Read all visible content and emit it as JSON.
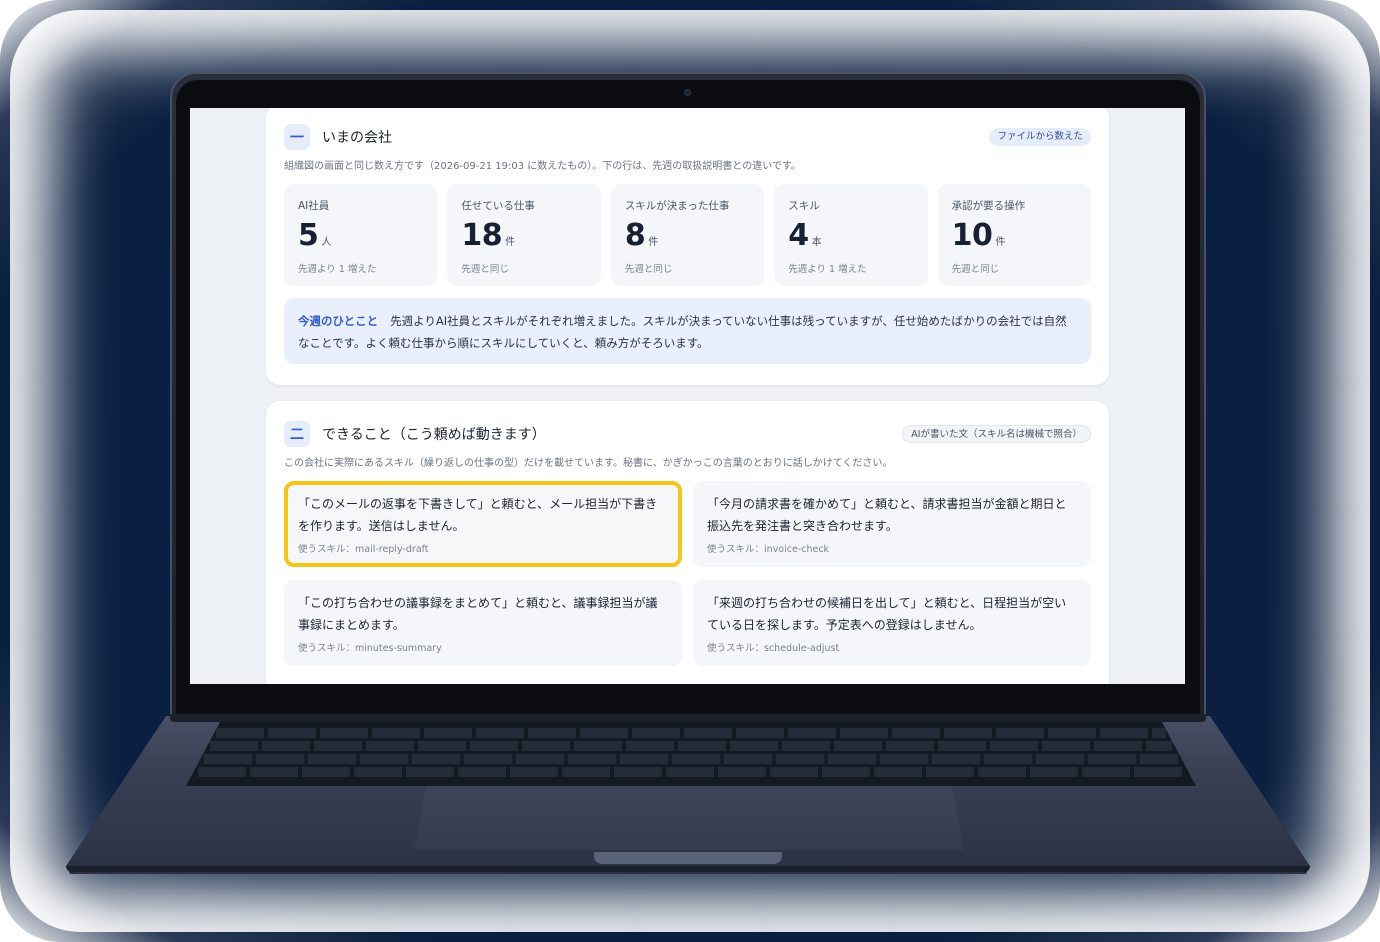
{
  "section1": {
    "number": "一",
    "title": "いまの会社",
    "badge": "ファイルから数えた",
    "description": "組織図の画面と同じ数え方です（2026-09-21 19:03 に数えたもの）。下の行は、先週の取扱説明書との違いです。",
    "stats": [
      {
        "label": "AI社員",
        "value": "5",
        "unit": "人",
        "sub": "先週より 1 増えた"
      },
      {
        "label": "任せている仕事",
        "value": "18",
        "unit": "件",
        "sub": "先週と同じ"
      },
      {
        "label": "スキルが決まった仕事",
        "value": "8",
        "unit": "件",
        "sub": "先週と同じ"
      },
      {
        "label": "スキル",
        "value": "4",
        "unit": "本",
        "sub": "先週より 1 増えた"
      },
      {
        "label": "承認が要る操作",
        "value": "10",
        "unit": "件",
        "sub": "先週と同じ"
      }
    ],
    "note_label": "今週のひとこと",
    "note_text": "先週よりAI社員とスキルがそれぞれ増えました。スキルが決まっていない仕事は残っていますが、任せ始めたばかりの会社では自然なことです。よく頼む仕事から順にスキルにしていくと、頼み方がそろいます。"
  },
  "section2": {
    "number": "二",
    "title": "できること（こう頼めば動きます）",
    "badge": "AIが書いた文（スキル名は機械で照合）",
    "description": "この会社に実際にあるスキル（繰り返しの仕事の型）だけを載せています。秘書に、かぎかっこの言葉のとおりに話しかけてください。",
    "tiles": [
      {
        "text": "「このメールの返事を下書きして」と頼むと、メール担当が下書きを作ります。送信はしません。",
        "skill": "使うスキル：mail-reply-draft"
      },
      {
        "text": "「今月の請求書を確かめて」と頼むと、請求書担当が金額と期日と振込先を発注書と突き合わせます。",
        "skill": "使うスキル：invoice-check"
      },
      {
        "text": "「この打ち合わせの議事録をまとめて」と頼むと、議事録担当が議事録にまとめます。",
        "skill": "使うスキル：minutes-summary"
      },
      {
        "text": "「来週の打ち合わせの候補日を出して」と頼むと、日程担当が空いている日を探します。予定表への登録はしません。",
        "skill": "使うスキル：schedule-adjust"
      }
    ]
  }
}
